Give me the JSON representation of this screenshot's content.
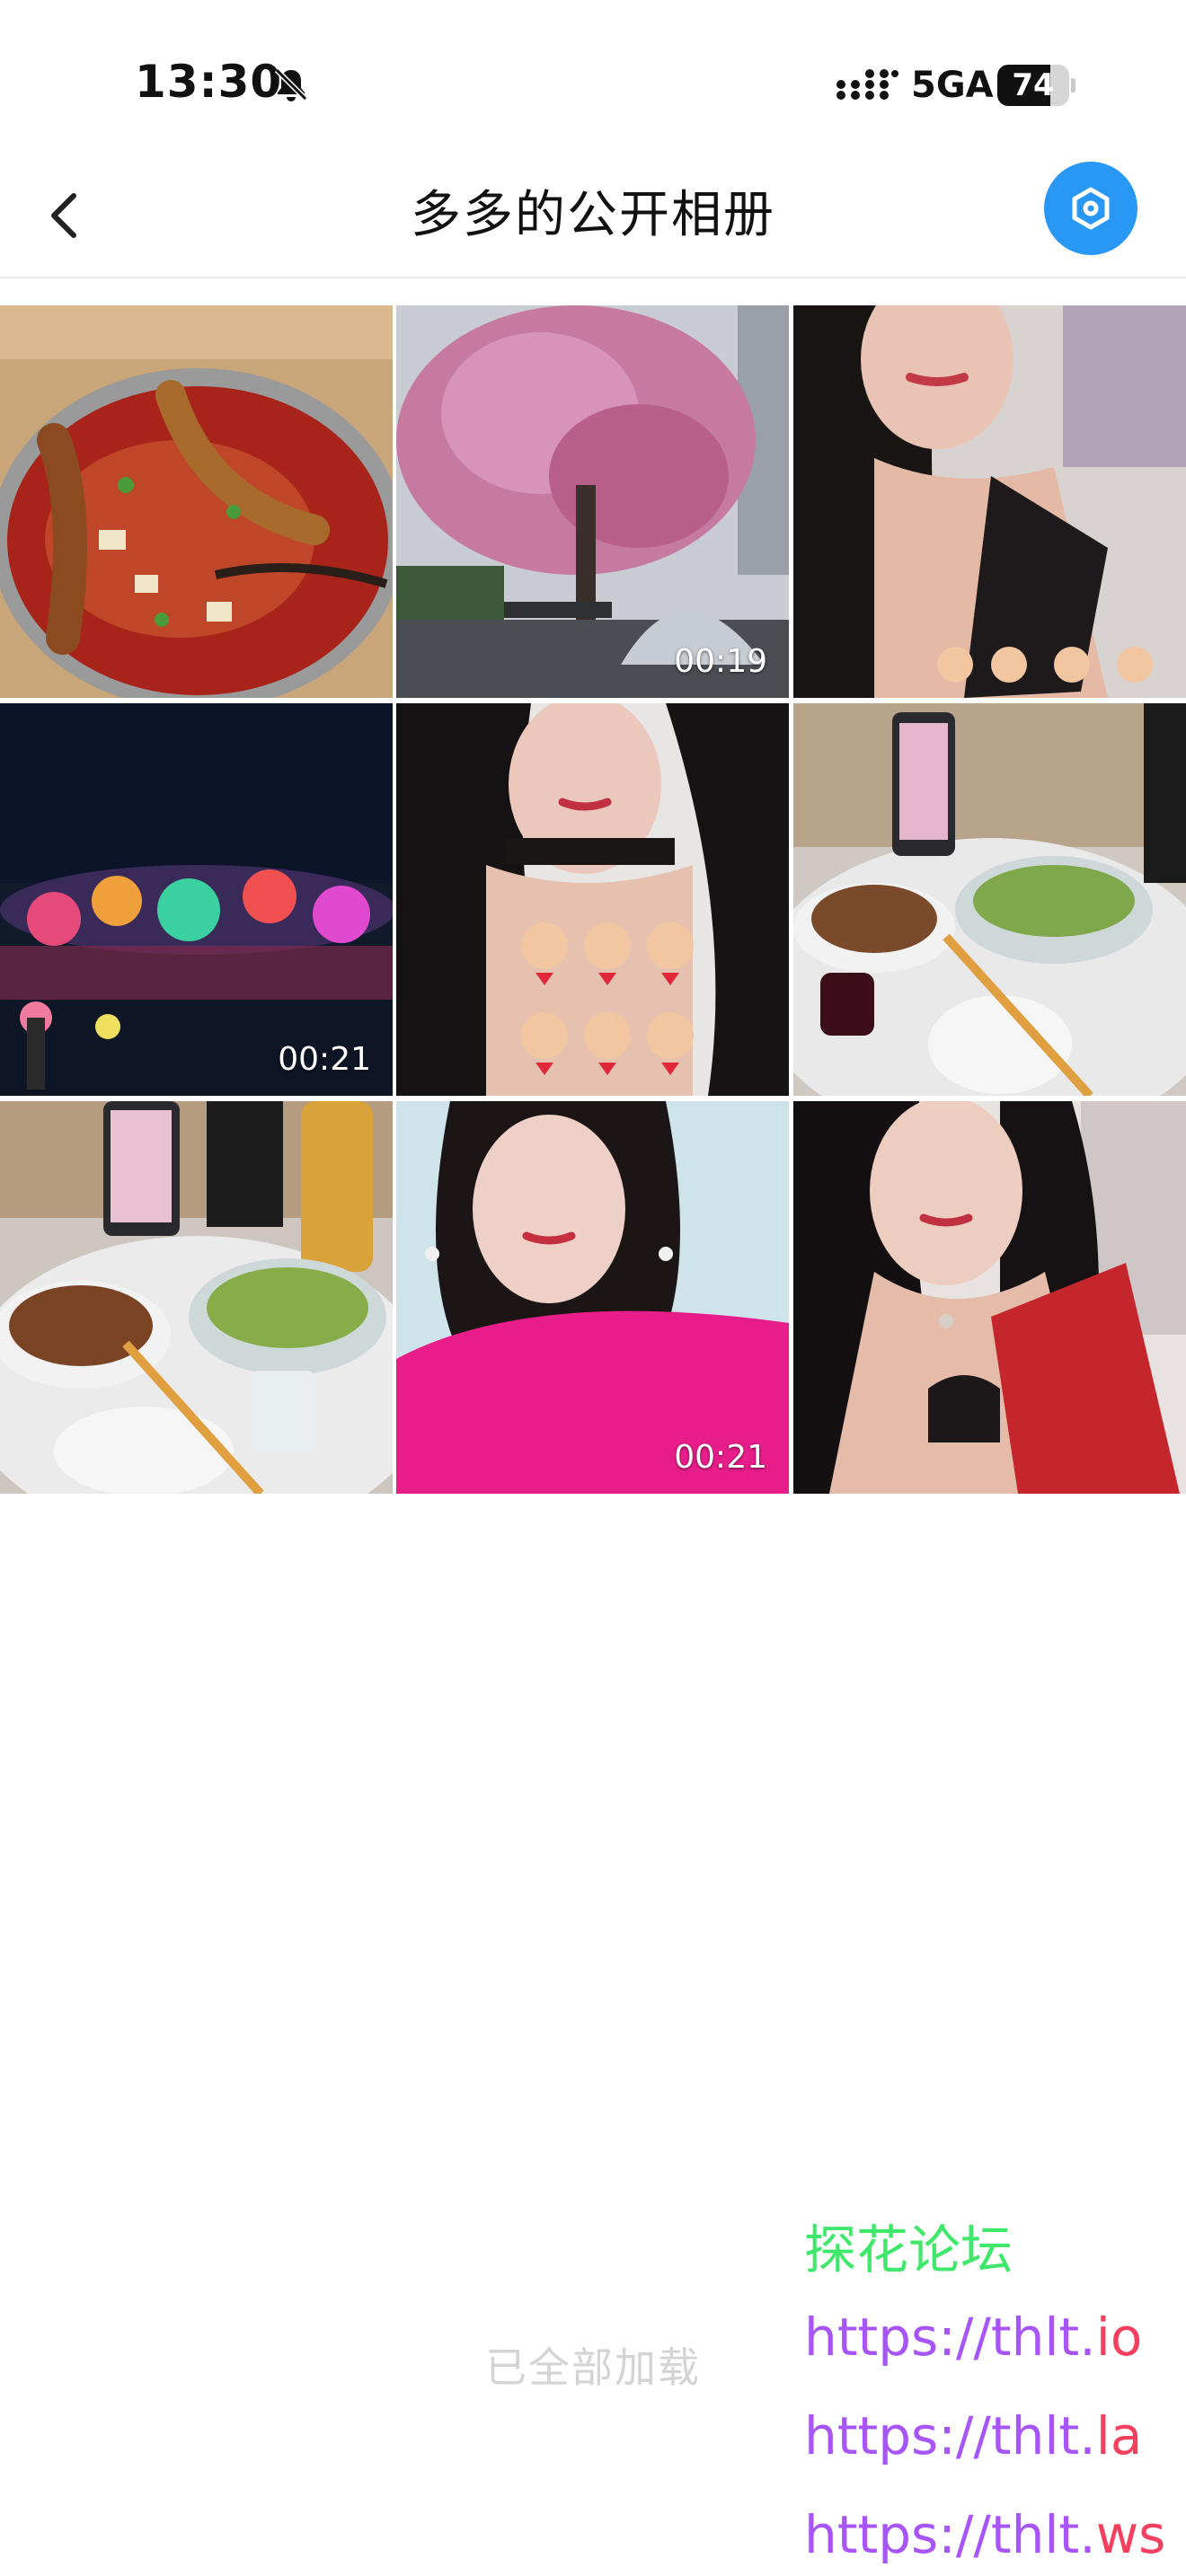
{
  "status_bar": {
    "time": "13:30",
    "network": "5GA",
    "battery_percent": "74",
    "battery_level": 0.74,
    "icons": [
      "bell-slash-icon",
      "signal-icon"
    ]
  },
  "nav": {
    "title": "多多的公开相册",
    "back_icon": "chevron-left-icon",
    "settings_icon": "hexagon-settings-icon",
    "accent_color": "#2998f5"
  },
  "grid": {
    "items": [
      {
        "type": "photo",
        "subject": "food-hotpot",
        "duration": ""
      },
      {
        "type": "video",
        "subject": "magnolia-tree",
        "duration": "00:19"
      },
      {
        "type": "photo",
        "subject": "selfie-woman",
        "duration": ""
      },
      {
        "type": "video",
        "subject": "lantern-festival",
        "duration": "00:21"
      },
      {
        "type": "photo",
        "subject": "selfie-woman",
        "duration": ""
      },
      {
        "type": "photo",
        "subject": "table-meal",
        "duration": ""
      },
      {
        "type": "photo",
        "subject": "table-meal",
        "duration": ""
      },
      {
        "type": "video",
        "subject": "selfie-pink",
        "duration": "00:21"
      },
      {
        "type": "photo",
        "subject": "selfie-red",
        "duration": ""
      }
    ]
  },
  "footer": {
    "loaded_text": "已全部加载"
  },
  "watermark": {
    "forum": "探花论坛",
    "urls": [
      {
        "base": "https://thlt.",
        "tld": "io"
      },
      {
        "base": "https://thlt.",
        "tld": "la"
      },
      {
        "base": "https://thlt.",
        "tld": "ws"
      }
    ],
    "colors": {
      "forum": "#3fe86a",
      "url": "#a855f7",
      "tld": "#f43f5e"
    }
  }
}
